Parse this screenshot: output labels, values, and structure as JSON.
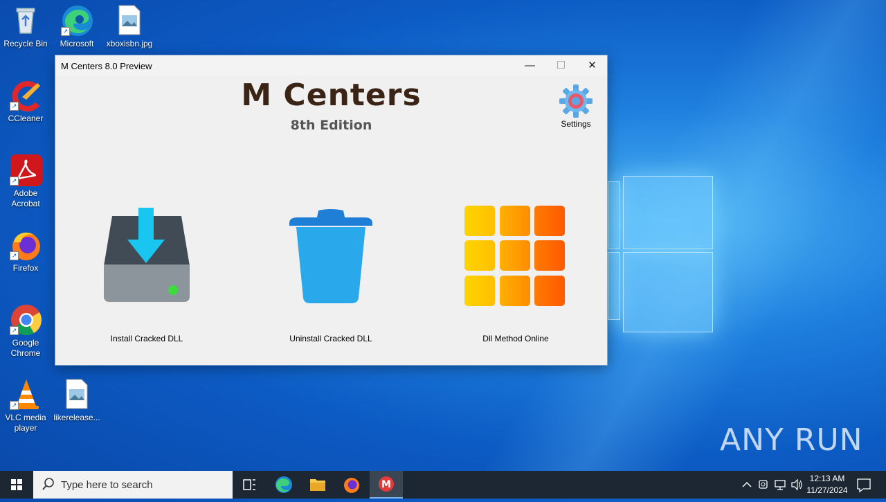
{
  "desktop": {
    "icons": [
      {
        "label": "Recycle Bin"
      },
      {
        "label": "Microsoft Edge"
      },
      {
        "label": "xboxisbn.jpg"
      },
      {
        "label": "CCleaner"
      },
      {
        "label": "Adobe Acrobat"
      },
      {
        "label": "Firefox"
      },
      {
        "label": "Google Chrome"
      },
      {
        "label": "VLC media player"
      },
      {
        "label": "likerelease..."
      }
    ]
  },
  "window": {
    "title": "M Centers 8.0 Preview",
    "minimize_glyph": "—",
    "maximize_glyph": "☐",
    "close_glyph": "✕",
    "app_title": "M Centers",
    "app_subtitle": "8th Edition",
    "settings_label": "Settings",
    "actions": [
      {
        "label": "Install Cracked DLL",
        "icon": "drive-download-icon"
      },
      {
        "label": "Uninstall Cracked DLL",
        "icon": "trash-bin-icon"
      },
      {
        "label": "Dll Method Online",
        "icon": "grid-icon"
      }
    ],
    "colors": {
      "title": "#3b2415",
      "subtitle": "#555555",
      "arrow": "#18c6f0",
      "bin": "#2aa8ec",
      "grid_start": "#ffd400",
      "grid_end": "#ff5a00"
    }
  },
  "taskbar": {
    "search_placeholder": "Type here to search",
    "time": "12:13 AM",
    "date": "11/27/2024"
  },
  "watermark": "ANY RUN"
}
